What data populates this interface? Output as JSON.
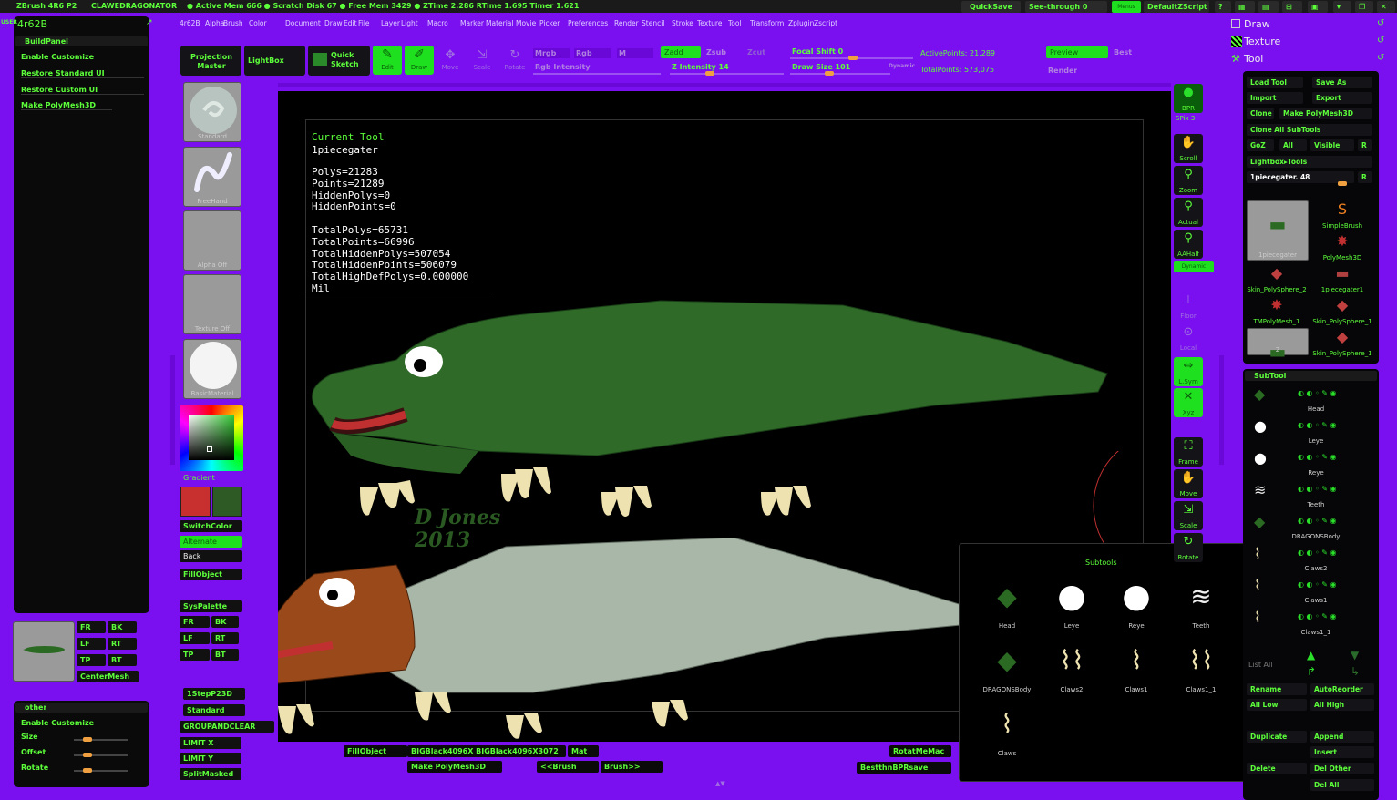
{
  "titlebar": {
    "app": "ZBrush 4R6 P2",
    "doc": "CLAWEDRAGONATOR",
    "stats": "● Active Mem 666 ● Scratch Disk 67 ● Free Mem 3429 ● ZTime 2.286 RTime 1.695 Timer 1.621",
    "quicksave": "QuickSave",
    "seethrough": "See-through",
    "seethrough_value": "0",
    "menus_label": "Menus",
    "defaultzscript": "DefaultZScript"
  },
  "menubar": [
    "4r62B",
    "Alpha",
    "Brush",
    "Color",
    "Document",
    "Draw",
    "Edit",
    "File",
    "Layer",
    "Light",
    "Macro",
    "Marker",
    "Material",
    "Movie",
    "Picker",
    "Preferences",
    "Render",
    "Stencil",
    "Stroke",
    "Texture",
    "Tool",
    "Transform",
    "Zplugin",
    "Zscript"
  ],
  "left_panel": {
    "header_tag": "USER",
    "title": "4r62B",
    "section": "BuildPanel",
    "items": [
      "Enable Customize",
      "Restore Standard UI",
      "Restore Custom UI",
      "Make PolyMesh3D"
    ]
  },
  "left_bottom": {
    "buttons": [
      "FR",
      "BK",
      "LF",
      "RT",
      "TP",
      "BT",
      "CenterMesh"
    ]
  },
  "other_panel": {
    "title": "other",
    "items": [
      "Enable Customize",
      "Size",
      "Offset",
      "Rotate"
    ]
  },
  "shelf": {
    "slot_labels": [
      "Standard",
      "FreeHand",
      "Alpha Off",
      "Texture Off",
      "BasicMaterial"
    ],
    "gradient": "Gradient",
    "switchcolor": "SwitchColor",
    "alternate": "Alternate",
    "back": "Back",
    "fillobject": "FillObject",
    "syspalette": "SysPalette",
    "view_buttons": [
      "FR",
      "BK",
      "LF",
      "RT",
      "TP",
      "BT"
    ],
    "lower": [
      "1StepP23D",
      "Standard",
      "GROUPANDCLEAR",
      "LIMIT X",
      "LIMIT Y",
      "SplitMasked"
    ]
  },
  "toolbar": {
    "projection_master": "Projection Master",
    "lightbox": "LightBox",
    "quick_sketch": "Quick Sketch",
    "edit": "Edit",
    "draw": "Draw",
    "move": "Move",
    "scale": "Scale",
    "rotate": "Rotate",
    "mrgb": "Mrgb",
    "rgb": "Rgb",
    "m": "M",
    "zadd": "Zadd",
    "zsub": "Zsub",
    "zcut": "Zcut",
    "rgb_intensity": "Rgb Intensity",
    "z_intensity": "Z Intensity 14",
    "focal_shift": "Focal Shift 0",
    "draw_size": "Draw Size 101",
    "dynamic": "Dynamic",
    "active_points": "ActivePoints: 21,289",
    "total_points": "TotalPoints: 573,075",
    "preview": "Preview",
    "best": "Best",
    "render": "Render"
  },
  "info": {
    "heading": "Current Tool",
    "name": "1piecegater",
    "lines": [
      "Polys=21283",
      "Points=21289",
      "HiddenPolys=0",
      "HiddenPoints=0",
      "",
      "TotalPolys=65731",
      "TotalPoints=66996",
      "TotalHiddenPolys=507054",
      "TotalHiddenPoints=506079",
      "TotalHighDefPolys=0.000000 Mil"
    ]
  },
  "watermark": {
    "line1": "D Jones",
    "line2": "2013"
  },
  "right_shelf": [
    "BPR",
    "SPix 3",
    "Scroll",
    "Zoom",
    "Actual",
    "AAHalf",
    "Dynamic",
    "Floor",
    "Local",
    "L.Sym",
    "Xyz",
    "Frame",
    "Move",
    "Scale",
    "Rotate"
  ],
  "right_panel": {
    "draw": "Draw",
    "texture": "Texture",
    "tool": "Tool",
    "tool_buttons": [
      "Load Tool",
      "Save As",
      "Import",
      "Export",
      "Clone",
      "Make PolyMesh3D",
      "Clone All SubTools",
      "GoZ",
      "All",
      "Visible",
      "R",
      "Lightbox▸Tools",
      "1piecegater. 48",
      "R"
    ],
    "tool_thumbs": [
      "1piecegater",
      "SimpleBrush",
      "PolyMesh3D",
      "Skin_PolySphere_2",
      "1piecegater1",
      "TMPolyMesh_1",
      "Skin_PolySphere_1",
      "2",
      "Skin_PolySphere_1"
    ],
    "subtool_title": "SubTool",
    "subtools": [
      "Head",
      "Leye",
      "Reye",
      "Teeth",
      "DRAGONSBody",
      "Claws2",
      "Claws1",
      "Claws1_1"
    ],
    "list_all": "List All",
    "bottom_buttons": [
      "Rename",
      "AutoReorder",
      "All Low",
      "All High",
      "Duplicate",
      "Append",
      "Insert",
      "Delete",
      "Del Other",
      "Del All"
    ]
  },
  "subtools_popup": {
    "title": "Subtools",
    "items": [
      "Head",
      "Leye",
      "Reye",
      "Teeth",
      "DRAGONSBody",
      "Claws2",
      "Claws1",
      "Claws1_1",
      "Claws"
    ]
  },
  "bottom_bar": [
    "FillObject",
    "BIGBlack4096X BIGBlack4096X3072",
    "Mat",
    "Make PolyMesh3D",
    "<<Brush",
    "Brush>>",
    "RotatMeMac",
    "BestthnBPRsave"
  ],
  "colors": {
    "accent": "#5cff3a",
    "background": "#7a10f0",
    "panel": "#060608",
    "primary": "#c83030",
    "secondary": "#2e5a26"
  }
}
